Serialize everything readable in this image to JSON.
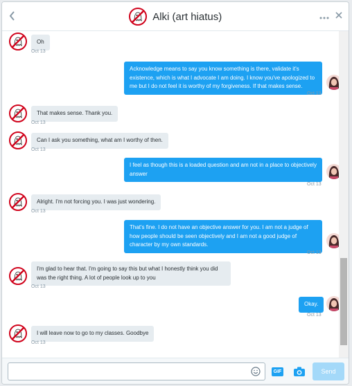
{
  "header": {
    "title": "Alki (art hiatus)",
    "back_icon": "chevron-left-icon",
    "more_icon": "more-horizontal-icon",
    "close_icon": "close-icon"
  },
  "messages": [
    {
      "side": "in",
      "text": "Oh",
      "time": "Oct 13"
    },
    {
      "side": "out",
      "text": "Acknowledge means to say you know something is there, validate it's existence, which is what I advocate I am doing. I know you've apologized to me but I do not feel it is worthy of my forgiveness. If that makes sense.",
      "time": "Oct 13"
    },
    {
      "side": "in",
      "text": "That makes sense. Thank you.",
      "time": "Oct 13"
    },
    {
      "side": "in",
      "text": "Can I ask you something, what am I worthy of then.",
      "time": "Oct 13"
    },
    {
      "side": "out",
      "text": "I feel as though this is a loaded question and am not in a place to objectively answer",
      "time": "Oct 13"
    },
    {
      "side": "in",
      "text": "Alright. I'm not forcing you. I was just wondering.",
      "time": "Oct 13"
    },
    {
      "side": "out",
      "text": "That's fine. I do not have an objective answer for you. I am not a judge of how people should be seen objectively and I am not a good judge of character by my own standards.",
      "time": "Oct 13"
    },
    {
      "side": "in",
      "text": "I'm glad to hear that. I'm going to say this but what I honestly think you did was the right thing. A lot of people look up to you",
      "time": "Oct 13"
    },
    {
      "side": "out",
      "text": "Okay.",
      "time": "Oct 13"
    },
    {
      "side": "in",
      "text": "I will leave now to go to my classes. Goodbye",
      "time": "Oct 13"
    }
  ],
  "composer": {
    "input_value": "",
    "emoji_icon": "emoji-icon",
    "gif_label": "GIF",
    "camera_icon": "camera-icon",
    "send_label": "Send"
  },
  "colors": {
    "outgoing_bubble": "#1da1f2",
    "incoming_bubble": "#e6ecf0",
    "timestamp": "#8899a6"
  }
}
